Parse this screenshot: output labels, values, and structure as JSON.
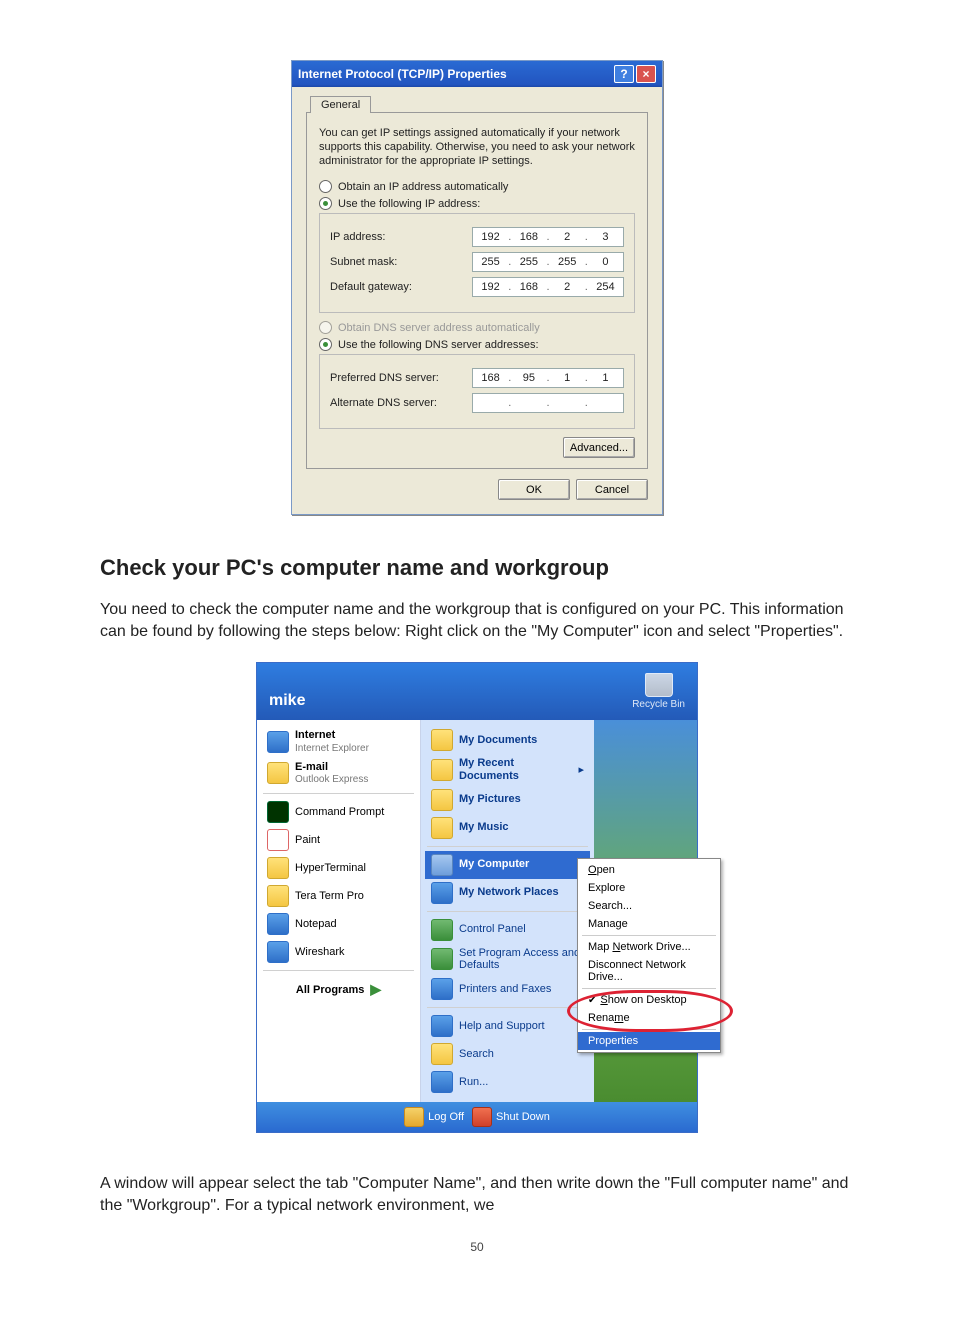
{
  "tcpip_dialog": {
    "title": "Internet Protocol (TCP/IP) Properties",
    "tab": "General",
    "intro": "You can get IP settings assigned automatically if your network supports this capability. Otherwise, you need to ask your network administrator for the appropriate IP settings.",
    "radio_auto_ip": "Obtain an IP address automatically",
    "radio_manual_ip": "Use the following IP address:",
    "ip_label": "IP address:",
    "ip_value": [
      "192",
      "168",
      "2",
      "3"
    ],
    "subnet_label": "Subnet mask:",
    "subnet_value": [
      "255",
      "255",
      "255",
      "0"
    ],
    "gateway_label": "Default gateway:",
    "gateway_value": [
      "192",
      "168",
      "2",
      "254"
    ],
    "radio_auto_dns": "Obtain DNS server address automatically",
    "radio_manual_dns": "Use the following DNS server addresses:",
    "pref_dns_label": "Preferred DNS server:",
    "pref_dns_value": [
      "168",
      "95",
      "1",
      "1"
    ],
    "alt_dns_label": "Alternate DNS server:",
    "alt_dns_value": [
      "",
      "",
      "",
      ""
    ],
    "advanced_btn": "Advanced...",
    "ok_btn": "OK",
    "cancel_btn": "Cancel"
  },
  "section_heading": "Check your PC's computer name and workgroup",
  "para1": "You need to check the computer name and the workgroup that is configured on your PC. This information can be found by following the steps below: Right click on the \"My Computer\" icon and select \"Properties\".",
  "start_menu": {
    "user": "mike",
    "recycle": "Recycle Bin",
    "left_pinned": [
      {
        "title": "Internet",
        "sub": "Internet Explorer"
      },
      {
        "title": "E-mail",
        "sub": "Outlook Express"
      }
    ],
    "left_recent": [
      "Command Prompt",
      "Paint",
      "HyperTerminal",
      "Tera Term Pro",
      "Notepad",
      "Wireshark"
    ],
    "all_programs": "All Programs",
    "right_top": [
      "My Documents",
      "My Recent Documents",
      "My Pictures",
      "My Music"
    ],
    "right_mid_hi": "My Computer",
    "right_mid": [
      "My Network Places"
    ],
    "right_sys": [
      "Control Panel",
      "Set Program Access and Defaults",
      "Printers and Faxes"
    ],
    "right_bottom": [
      "Help and Support",
      "Search",
      "Run..."
    ],
    "logoff": "Log Off",
    "shutdown": "Shut Down"
  },
  "context_menu": {
    "open_u": "O",
    "open_rest": "pen",
    "items_top": [
      "Explore",
      "Search...",
      "Manage"
    ],
    "map_pre": "Map ",
    "map_u": "N",
    "map_post": "etwork Drive...",
    "disconnect": "Disconnect Network Drive...",
    "show_pre": "",
    "show_u": "S",
    "show_post": "how on Desktop",
    "rename_pre": "Rena",
    "rename_u": "m",
    "rename_post": "e",
    "properties": "Properties"
  },
  "para2": "A window will appear select the tab \"Computer Name\", and then write down the \"Full computer name\" and the \"Workgroup\". For a typical network environment, we",
  "page_number": "50"
}
